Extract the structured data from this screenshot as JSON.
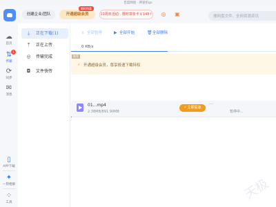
{
  "window": {
    "title": "百度网盘 · 神爱织go"
  },
  "header": {
    "create_team": "创建企业/团队",
    "vip_button": "开通超级会员",
    "vip_badge": "限时特惠",
    "promo_text": "11周年活动：限时享年卡￥148↑",
    "game_icon": "gamepad-icon",
    "gift_icon": "gift-icon",
    "search_placeholder": "搜网盘文件、全网资源资讯"
  },
  "nav": {
    "items": [
      {
        "label": "首页",
        "icon": "cloud-icon"
      },
      {
        "label": "传输",
        "icon": "transfer-icon",
        "badge": "1"
      },
      {
        "label": "同步",
        "icon": "sync-icon"
      },
      {
        "label": "消息",
        "icon": "message-icon"
      }
    ],
    "bottom": [
      {
        "label": "APP下载",
        "icon": "phone-icon"
      },
      {
        "label": "一刻相册",
        "icon": "photo-album-icon"
      },
      {
        "label": "工具",
        "icon": "apps-grid-icon"
      }
    ]
  },
  "transfer_menu": {
    "items": [
      {
        "label": "正在下载(1)",
        "icon": "download-icon",
        "active": true
      },
      {
        "label": "正在上传",
        "icon": "upload-icon",
        "active": false
      },
      {
        "label": "传输完成",
        "icon": "check-circle-icon",
        "active": false
      },
      {
        "label": "文件快传",
        "icon": "quick-transfer-icon",
        "active": false
      }
    ]
  },
  "toolbar": {
    "pause_all": "全部暂停",
    "start_all": "全部开始",
    "delete_all": "全部删除"
  },
  "speed": "0 KB/s",
  "promo_bar": {
    "tag": "推荐",
    "text": "开通超级会员，尊享极速下载特权"
  },
  "task": {
    "file_name": "01...mp4",
    "file_size": "2.38MB/891.90MB",
    "accelerate": "立即提速",
    "status": "暂停中...",
    "progress_fraction": 0.003
  },
  "colors": {
    "accent": "#3f7ff3",
    "vip_text": "#c56a12",
    "promo_red": "#e5483a",
    "accelerate": "#f39b1c"
  }
}
